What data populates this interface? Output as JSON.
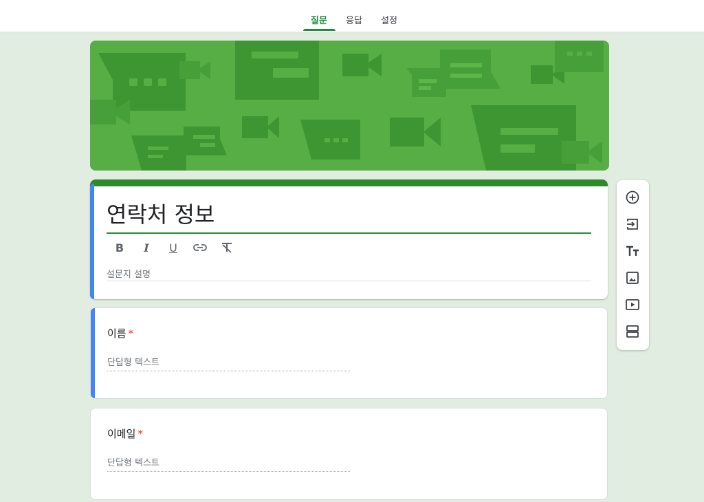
{
  "tabs": [
    {
      "label": "질문"
    },
    {
      "label": "응답"
    },
    {
      "label": "설정"
    }
  ],
  "form": {
    "title": "연락처 정보",
    "description_placeholder": "설문지 설명"
  },
  "format_toolbar": {
    "bold_label": "B",
    "italic_label": "I",
    "underline_label": "U"
  },
  "questions": [
    {
      "title": "이름",
      "required_mark": "*",
      "answer_placeholder": "단답형 텍스트"
    },
    {
      "title": "이메일",
      "required_mark": "*",
      "answer_placeholder": "단답형 텍스트"
    }
  ],
  "side_toolbar": {
    "icons": [
      "add-question-icon",
      "import-questions-icon",
      "add-title-icon",
      "add-image-icon",
      "add-video-icon",
      "add-section-icon"
    ]
  },
  "colors": {
    "accent": "#1e8e3e",
    "banner": "#56ae45",
    "title_bar": "#2f8a2b",
    "active_card": "#4285f4",
    "background": "#e2ede1",
    "required": "#d93025"
  }
}
